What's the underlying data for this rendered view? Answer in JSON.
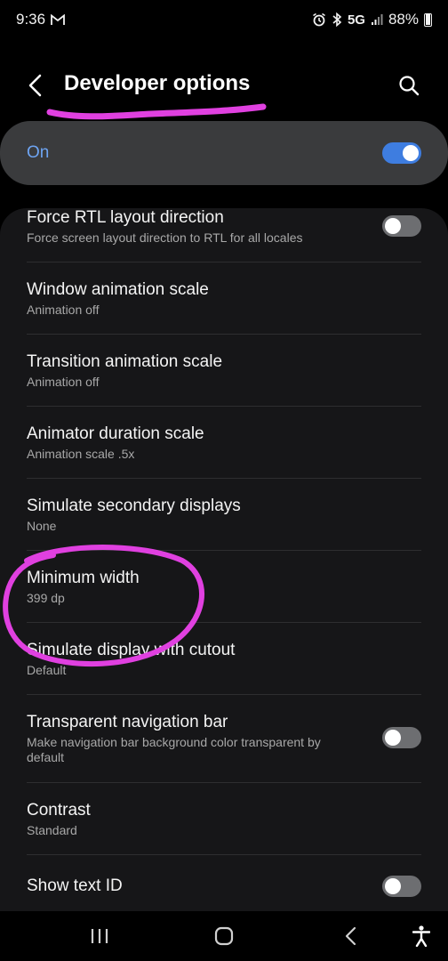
{
  "status_bar": {
    "time": "9:36",
    "network": "5G",
    "battery": "88%",
    "icons": [
      "gmail-icon",
      "alarm-icon",
      "bluetooth-icon",
      "signal-icon",
      "battery-icon"
    ]
  },
  "header": {
    "title": "Developer options",
    "back_icon": "back-arrow-icon",
    "search_icon": "search-icon"
  },
  "master_switch": {
    "label": "On",
    "state": true,
    "accent_color": "#3e7de0"
  },
  "settings": [
    {
      "title": "Force RTL layout direction",
      "subtitle": "Force screen layout direction to RTL for all locales",
      "toggle": false
    },
    {
      "title": "Window animation scale",
      "subtitle": "Animation off"
    },
    {
      "title": "Transition animation scale",
      "subtitle": "Animation off"
    },
    {
      "title": "Animator duration scale",
      "subtitle": "Animation scale .5x"
    },
    {
      "title": "Simulate secondary displays",
      "subtitle": "None"
    },
    {
      "title": "Minimum width",
      "subtitle": "399 dp"
    },
    {
      "title": "Simulate display with cutout",
      "subtitle": "Default"
    },
    {
      "title": "Transparent navigation bar",
      "subtitle": "Make navigation bar background color transparent by default",
      "toggle": false
    },
    {
      "title": "Contrast",
      "subtitle": "Standard"
    },
    {
      "title": "Show text ID",
      "toggle": false
    }
  ],
  "annotations": {
    "color": "#e040e0",
    "marks": [
      "underline-title",
      "circle-minimum-width"
    ]
  },
  "nav_bar": {
    "buttons": [
      "recent-apps-icon",
      "home-icon",
      "back-icon",
      "accessibility-icon"
    ]
  }
}
